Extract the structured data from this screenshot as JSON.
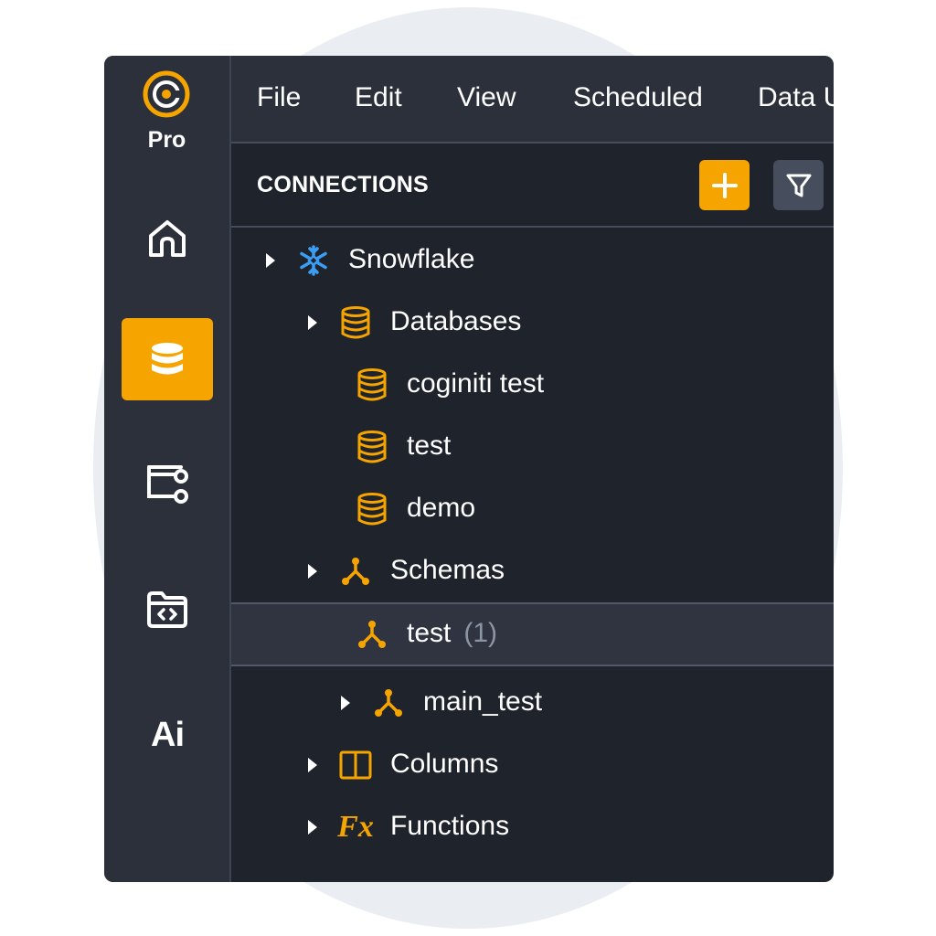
{
  "app": {
    "edition_label": "Pro",
    "accent_color": "#f5a400",
    "rail_background": "#2b303b",
    "panel_background": "#1f232b"
  },
  "rail": {
    "items": [
      {
        "name": "home",
        "icon": "home-icon",
        "active": false
      },
      {
        "name": "database",
        "icon": "database-icon",
        "active": true
      },
      {
        "name": "workflow",
        "icon": "workflow-icon",
        "active": false
      },
      {
        "name": "code-folder",
        "icon": "code-folder-icon",
        "active": false
      },
      {
        "name": "ai",
        "label": "Ai",
        "active": false
      }
    ]
  },
  "menubar": {
    "items": [
      "File",
      "Edit",
      "View",
      "Scheduled",
      "Data U"
    ]
  },
  "connections": {
    "title": "CONNECTIONS",
    "add_icon": "plus-icon",
    "filter_icon": "filter-icon"
  },
  "tree": {
    "rows": [
      {
        "label": "Snowflake",
        "icon": "snowflake-icon",
        "expandable": true
      },
      {
        "label": "Databases",
        "icon": "database-icon",
        "expandable": true
      },
      {
        "label": "coginiti test",
        "icon": "database-icon",
        "expandable": false
      },
      {
        "label": "test",
        "icon": "database-icon",
        "expandable": false
      },
      {
        "label": "demo",
        "icon": "database-icon",
        "expandable": false
      },
      {
        "label": "Schemas",
        "icon": "schema-icon",
        "expandable": true
      },
      {
        "label": "test",
        "count": "(1)",
        "icon": "schema-icon",
        "expandable": false,
        "selected": true
      },
      {
        "label": "main_test",
        "icon": "schema-icon",
        "expandable": true
      },
      {
        "label": "Columns",
        "icon": "columns-icon",
        "expandable": true
      },
      {
        "label": "Functions",
        "icon": "functions-icon",
        "icon_text": "Fx",
        "expandable": true
      }
    ]
  }
}
